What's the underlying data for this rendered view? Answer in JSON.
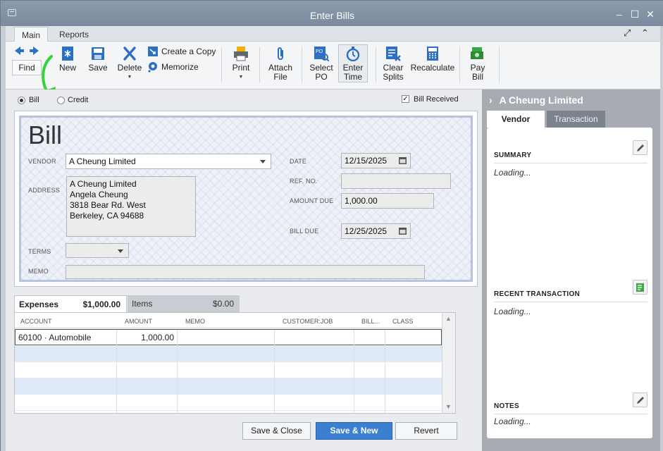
{
  "window": {
    "title": "Enter Bills"
  },
  "ribbon_tabs": [
    "Main",
    "Reports"
  ],
  "toolbar": {
    "find": "Find",
    "new": "New",
    "save": "Save",
    "delete": "Delete",
    "create_copy": "Create a Copy",
    "memorize": "Memorize",
    "print": "Print",
    "attach_file": [
      "Attach",
      "File"
    ],
    "select_po": [
      "Select",
      "PO"
    ],
    "enter_time": [
      "Enter",
      "Time"
    ],
    "clear_splits": [
      "Clear",
      "Splits"
    ],
    "recalculate": "Recalculate",
    "pay_bill": [
      "Pay",
      "Bill"
    ]
  },
  "mode": {
    "bill_label": "Bill",
    "credit_label": "Credit",
    "bill_received_label": "Bill Received",
    "selected": "Bill",
    "bill_received": true
  },
  "form": {
    "heading": "Bill",
    "vendor_label": "VENDOR",
    "vendor": "A Cheung Limited",
    "address_label": "ADDRESS",
    "address_lines": [
      "A Cheung Limited",
      "Angela Cheung",
      "3818 Bear Rd. West",
      "Berkeley, CA 94688"
    ],
    "terms_label": "TERMS",
    "terms": "",
    "memo_label": "MEMO",
    "memo": "",
    "date_label": "DATE",
    "date": "12/15/2025",
    "ref_label": "REF. NO.",
    "ref": "",
    "amount_due_label": "AMOUNT DUE",
    "amount_due": "1,000.00",
    "bill_due_label": "BILL DUE",
    "bill_due": "12/25/2025"
  },
  "grid_tabs": {
    "expenses_label": "Expenses",
    "expenses_total": "$1,000.00",
    "items_label": "Items",
    "items_total": "$0.00"
  },
  "grid": {
    "columns": [
      "ACCOUNT",
      "AMOUNT",
      "MEMO",
      "CUSTOMER:JOB",
      "BILL...",
      "CLASS"
    ],
    "rows": [
      {
        "account": "60100 · Automobile",
        "amount": "1,000.00",
        "memo": "",
        "customer_job": "",
        "billable": "",
        "class": ""
      }
    ]
  },
  "buttons": {
    "save_close": "Save & Close",
    "save_new": "Save & New",
    "revert": "Revert"
  },
  "side_panel": {
    "vendor_name": "A Cheung Limited",
    "tabs": [
      "Vendor",
      "Transaction"
    ],
    "summary_label": "SUMMARY",
    "summary": "Loading...",
    "recent_label": "RECENT TRANSACTION",
    "recent": "Loading...",
    "notes_label": "NOTES",
    "notes": "Loading..."
  },
  "colors": {
    "accent": "#3a7fd0",
    "annotation_arrow": "#35d23b"
  }
}
